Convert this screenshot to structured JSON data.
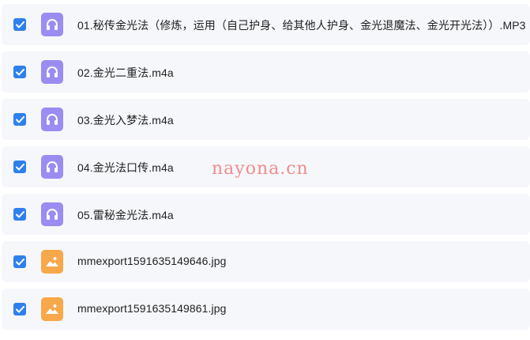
{
  "files": [
    {
      "name": "01.秘传金光法（修炼，运用（自己护身、给其他人护身、金光退魔法、金光开光法））.MP3",
      "type": "audio",
      "checked": true
    },
    {
      "name": "02.金光二重法.m4a",
      "type": "audio",
      "checked": true
    },
    {
      "name": "03.金光入梦法.m4a",
      "type": "audio",
      "checked": true
    },
    {
      "name": "04.金光法口传.m4a",
      "type": "audio",
      "checked": true
    },
    {
      "name": "05.雷秘金光法.m4a",
      "type": "audio",
      "checked": true
    },
    {
      "name": "mmexport1591635149646.jpg",
      "type": "image",
      "checked": true
    },
    {
      "name": "mmexport1591635149861.jpg",
      "type": "image",
      "checked": true
    }
  ],
  "watermark": "nayona.cn",
  "colors": {
    "checkbox": "#2f80ed",
    "audio_icon": "#9b8cf2",
    "image_icon": "#f7a84a",
    "row_bg": "#f6f7fb"
  },
  "icons": {
    "audio": "headphones-icon",
    "image": "image-icon",
    "check": "checkmark-icon"
  }
}
